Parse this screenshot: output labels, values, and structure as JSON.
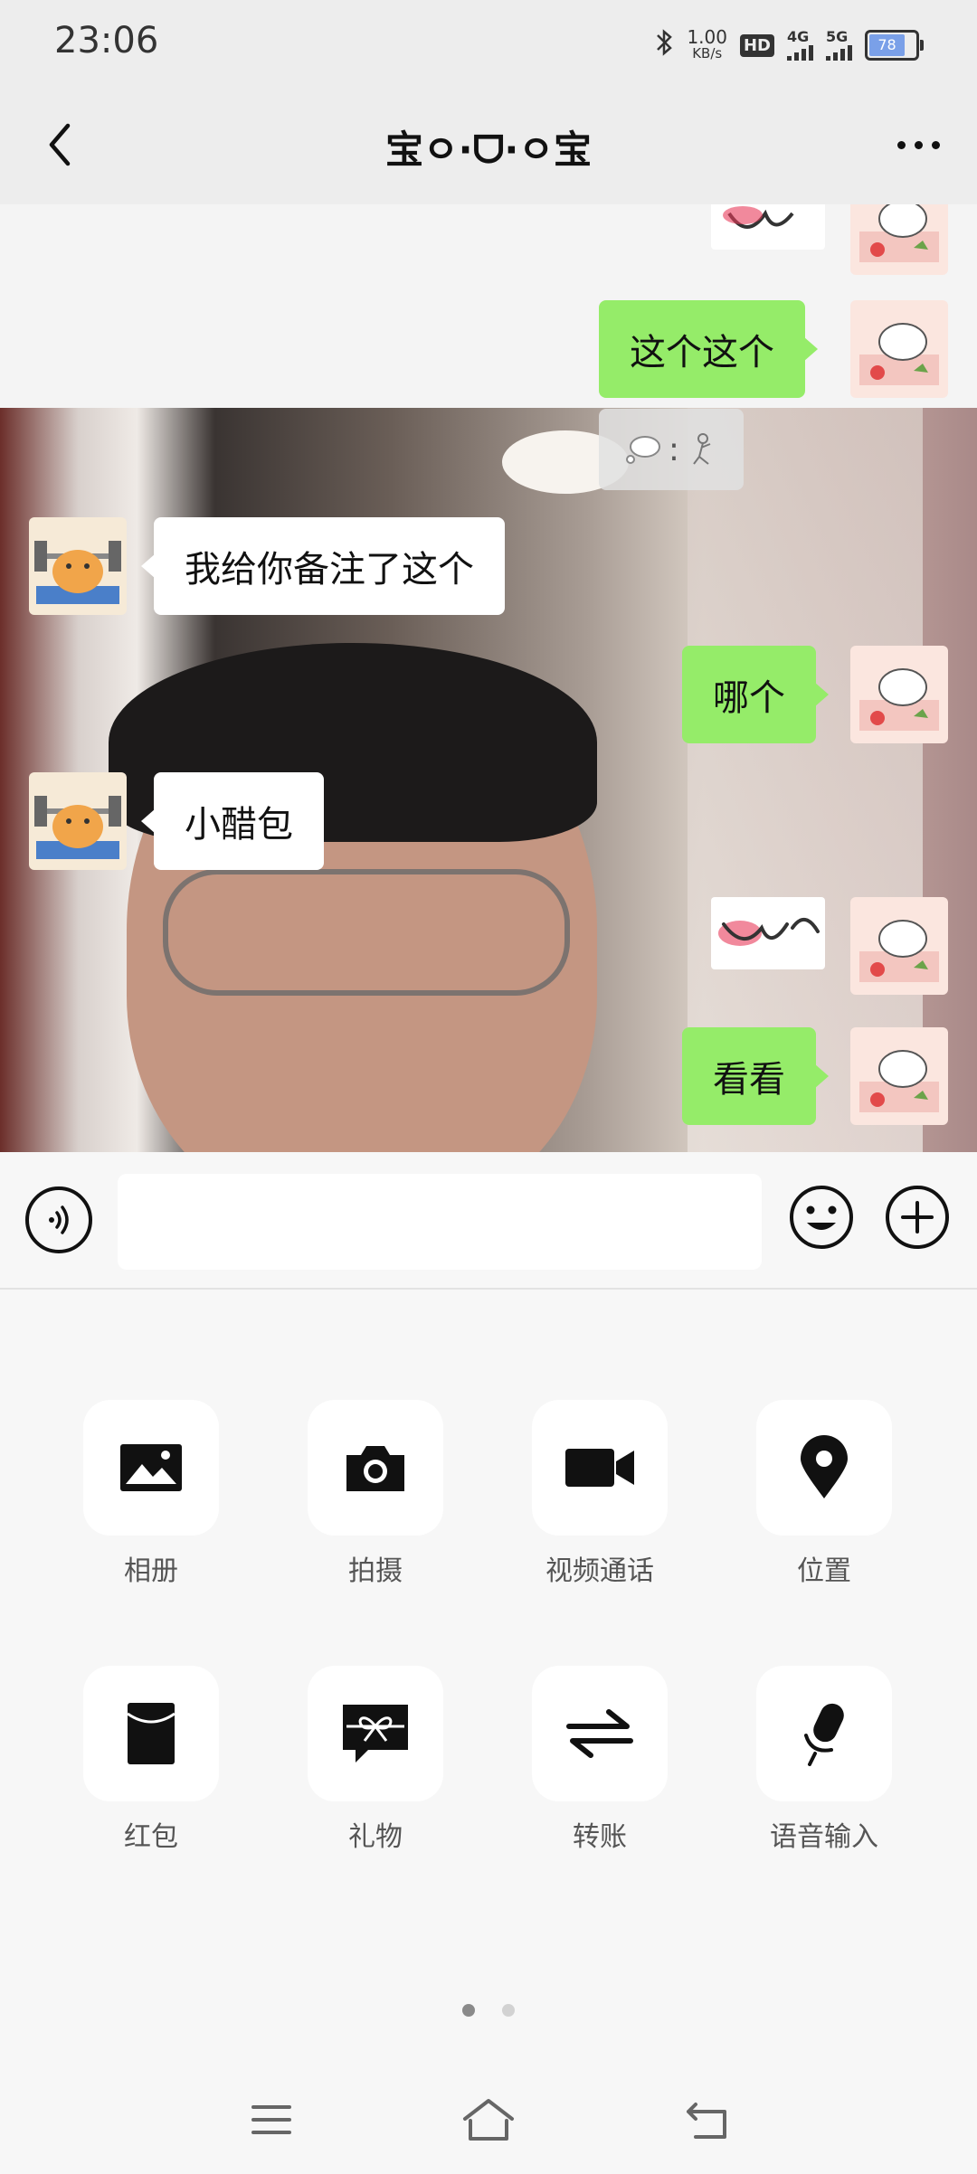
{
  "status_bar": {
    "time": "23:06",
    "speed_value": "1.00",
    "speed_unit": "KB/s",
    "hd_badge": "HD",
    "sim1_network": "4G",
    "sim2_network": "5G",
    "battery_level": "78",
    "battery_color": "#7aa0e8"
  },
  "header": {
    "title": "宝ㅇ·ᗜ·ㅇ宝"
  },
  "chat": {
    "pat_symbol": ":",
    "messages": [
      {
        "side": "right",
        "type": "sticker"
      },
      {
        "side": "right",
        "type": "text",
        "text": "这个这个"
      },
      {
        "side": "center",
        "type": "pat"
      },
      {
        "side": "left",
        "type": "text",
        "text": "我给你备注了这个"
      },
      {
        "side": "right",
        "type": "text",
        "text": "哪个"
      },
      {
        "side": "left",
        "type": "text",
        "text": "小醋包"
      },
      {
        "side": "right",
        "type": "sticker"
      },
      {
        "side": "right",
        "type": "text",
        "text": "看看"
      }
    ],
    "bubble_colors": {
      "me": "#95ec69",
      "other": "#ffffff"
    }
  },
  "input_bar": {
    "value": "",
    "placeholder": "",
    "voice_icon": "voice-icon",
    "emoji_icon": "emoji-icon",
    "plus_icon": "plus-icon"
  },
  "panel": {
    "items": [
      {
        "label": "相册",
        "icon": "album-icon"
      },
      {
        "label": "拍摄",
        "icon": "camera-icon"
      },
      {
        "label": "视频通话",
        "icon": "video-call-icon"
      },
      {
        "label": "位置",
        "icon": "location-icon"
      },
      {
        "label": "红包",
        "icon": "red-packet-icon"
      },
      {
        "label": "礼物",
        "icon": "gift-icon"
      },
      {
        "label": "转账",
        "icon": "transfer-icon"
      },
      {
        "label": "语音输入",
        "icon": "microphone-icon"
      }
    ],
    "pages": 2,
    "current_page": 1
  },
  "nav_bar": {
    "buttons": [
      "menu-icon",
      "home-icon",
      "back-icon"
    ]
  }
}
